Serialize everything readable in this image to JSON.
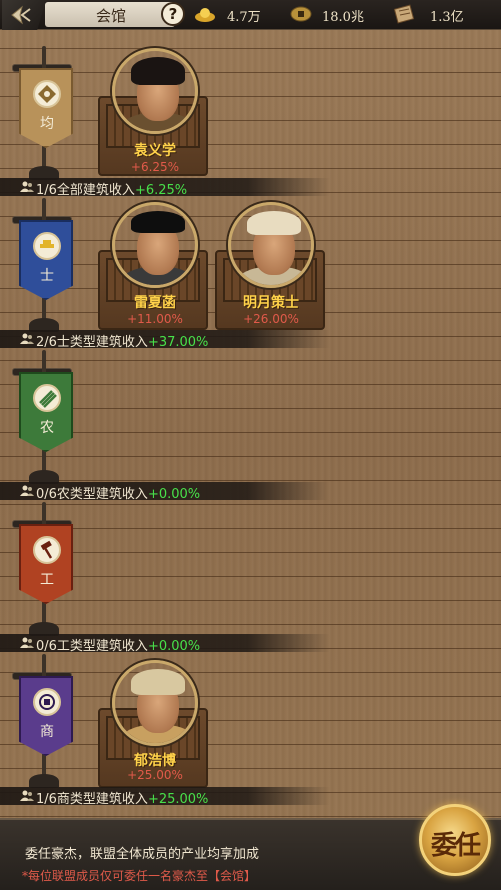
{
  "header": {
    "title": "会馆",
    "help_label": "?",
    "resources": [
      {
        "icon": "gold-ingot-icon",
        "value": "4.7万"
      },
      {
        "icon": "coin-icon",
        "value": "18.0兆"
      },
      {
        "icon": "scroll-icon",
        "value": "1.3亿"
      }
    ]
  },
  "groups": [
    {
      "banner_char": "均",
      "banner_color": "#b8925a",
      "heroes": [
        {
          "name": "袁义学",
          "bonus": "+6.25%"
        }
      ],
      "income": {
        "count": "1/6",
        "label": "全部建筑收入",
        "value": "+6.25%"
      }
    },
    {
      "banner_char": "士",
      "banner_color": "#2f4e9a",
      "heroes": [
        {
          "name": "雷夏菡",
          "bonus": "+11.00%"
        },
        {
          "name": "明月策士",
          "bonus": "+26.00%"
        }
      ],
      "income": {
        "count": "2/6",
        "label": "士类型建筑收入",
        "value": "+37.00%"
      }
    },
    {
      "banner_char": "农",
      "banner_color": "#3d7a3a",
      "heroes": [],
      "income": {
        "count": "0/6",
        "label": "农类型建筑收入",
        "value": "+0.00%"
      }
    },
    {
      "banner_char": "工",
      "banner_color": "#b04222",
      "heroes": [],
      "income": {
        "count": "0/6",
        "label": "工类型建筑收入",
        "value": "+0.00%"
      }
    },
    {
      "banner_char": "商",
      "banner_color": "#5a3c8c",
      "heroes": [
        {
          "name": "郁浩博",
          "bonus": "+25.00%"
        }
      ],
      "income": {
        "count": "1/6",
        "label": "商类型建筑收入",
        "value": "+25.00%"
      }
    }
  ],
  "footer": {
    "line1": "委任豪杰，联盟全体成员的产业均享加成",
    "line2": "*每位联盟成员仅可委任一名豪杰至【会馆】",
    "appoint_button": "委任"
  }
}
